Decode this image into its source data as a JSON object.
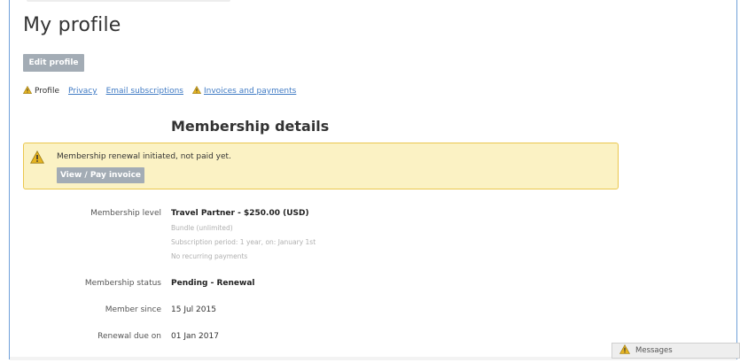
{
  "page": {
    "title": "My profile"
  },
  "toolbar": {
    "edit_profile_label": "Edit profile"
  },
  "tabs": [
    {
      "label": "Profile",
      "warning": true
    },
    {
      "label": "Privacy",
      "warning": false
    },
    {
      "label": "Email subscriptions",
      "warning": false
    },
    {
      "label": "Invoices and payments",
      "warning": true
    }
  ],
  "section": {
    "title": "Membership details"
  },
  "notice": {
    "text": "Membership renewal initiated, not paid yet.",
    "button_label": "View / Pay invoice",
    "icon": "warning-icon",
    "colors": {
      "background": "#fbf2c4",
      "border": "#eac74f"
    }
  },
  "details": {
    "level": {
      "label": "Membership level",
      "value": "Travel Partner - $250.00 (USD)",
      "sub": [
        "Bundle (unlimited)",
        "Subscription period: 1 year, on: January 1st",
        "No recurring payments"
      ]
    },
    "status": {
      "label": "Membership status",
      "value": "Pending - Renewal"
    },
    "since": {
      "label": "Member since",
      "value": "15 Jul 2015"
    },
    "renewal": {
      "label": "Renewal due on",
      "value": "01 Jan 2017"
    }
  },
  "messages": {
    "label": "Messages",
    "icon": "warning-icon"
  }
}
